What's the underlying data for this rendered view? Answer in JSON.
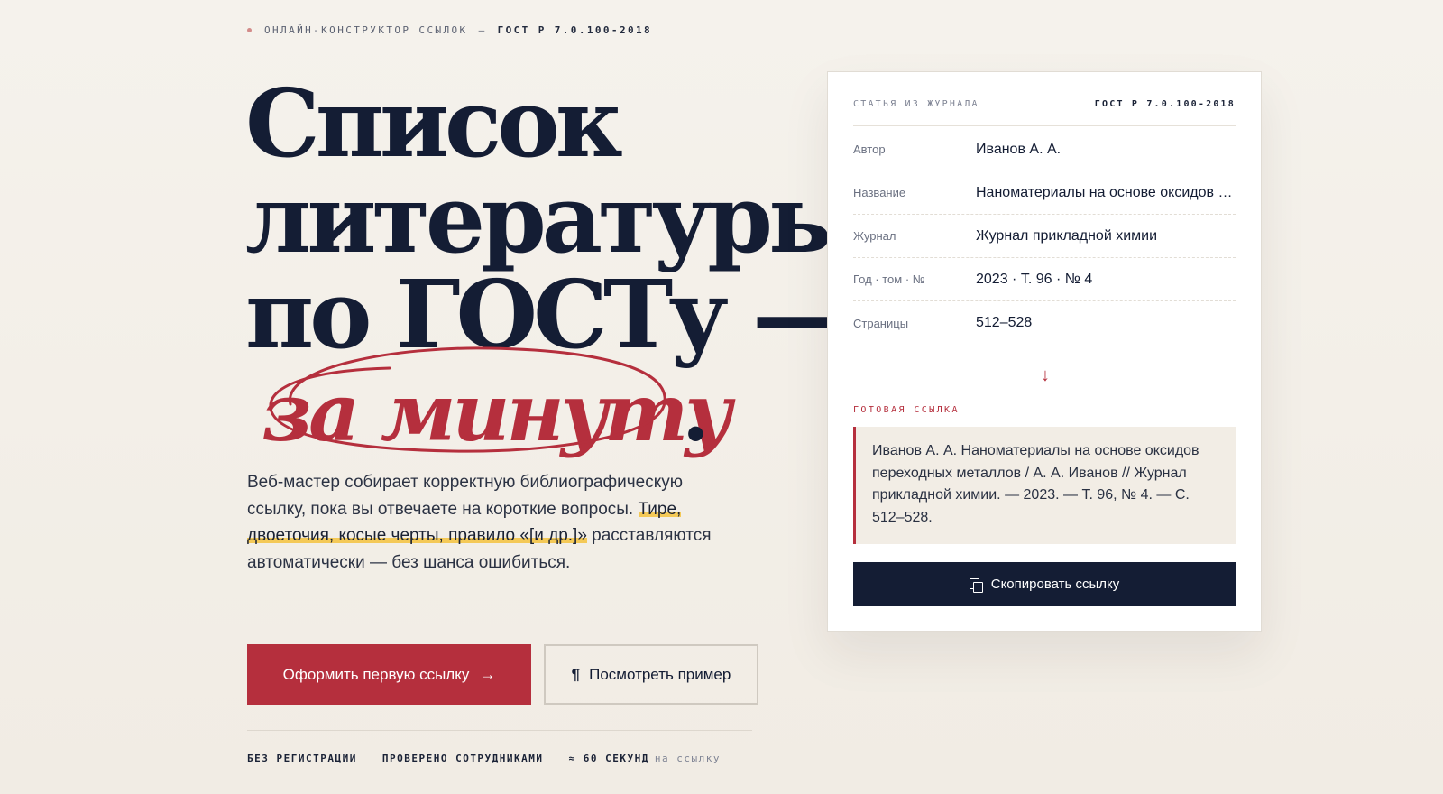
{
  "eyebrow": {
    "prefix": "ОНЛАЙН-КОНСТРУКТОР ССЫЛОК",
    "dash": "—",
    "standard": "ГОСТ Р 7.0.100-2018"
  },
  "headline": {
    "line1": "Список",
    "line2": "литературы",
    "line3": "по ГОСТу —",
    "accent": "за минуту",
    "period": "."
  },
  "lead": {
    "text_start": "Веб-мастер собирает корректную библиографическую ссылку, пока вы отвечаете на короткие вопросы.",
    "highlight": "Тире, двоеточия, косые черты, правило «[и др.]»",
    "text_end": "расставляются автоматически — без шанса ошибиться."
  },
  "buttons": {
    "primary_label": "Оформить первую ссылку",
    "primary_arrow": "→",
    "secondary_icon": "¶",
    "secondary_label": "Посмотреть пример"
  },
  "features": {
    "f1": "БЕЗ РЕГИСТРАЦИИ",
    "f2": "ПРОВЕРЕНО СОТРУДНИКАМИ",
    "f3_strong": "≈ 60 СЕКУНД",
    "f3_muted": "на ссылку"
  },
  "card": {
    "type": "СТАТЬЯ ИЗ ЖУРНАЛА",
    "standard": "ГОСТ Р 7.0.100-2018",
    "fields": [
      {
        "label": "Автор",
        "value": "Иванов А. А."
      },
      {
        "label": "Название",
        "value": "Наноматериалы на основе оксидов переходных металлов"
      },
      {
        "label": "Журнал",
        "value": "Журнал прикладной химии"
      },
      {
        "label": "Год · том · №",
        "value": "2023 · Т. 96 · № 4"
      },
      {
        "label": "Страницы",
        "value": "512–528"
      }
    ],
    "arrow": "↓",
    "ready_label": "ГОТОВАЯ ССЫЛКА",
    "result": "Иванов А. А. Наноматериалы на основе оксидов переходных металлов / А. А. Иванов // Журнал прикладной химии. — 2023. — Т. 96, № 4. — С. 512–528.",
    "copy_label": "Скопировать ссылку"
  },
  "colors": {
    "accent": "#b52f3d",
    "ink": "#141d34",
    "highlight": "#f4c957",
    "background": "#f3efe8"
  },
  "icons": {
    "copy": "copy-icon",
    "arrow_right": "arrow-right-icon",
    "pilcrow": "pilcrow-icon",
    "arrow_down": "arrow-down-icon"
  }
}
